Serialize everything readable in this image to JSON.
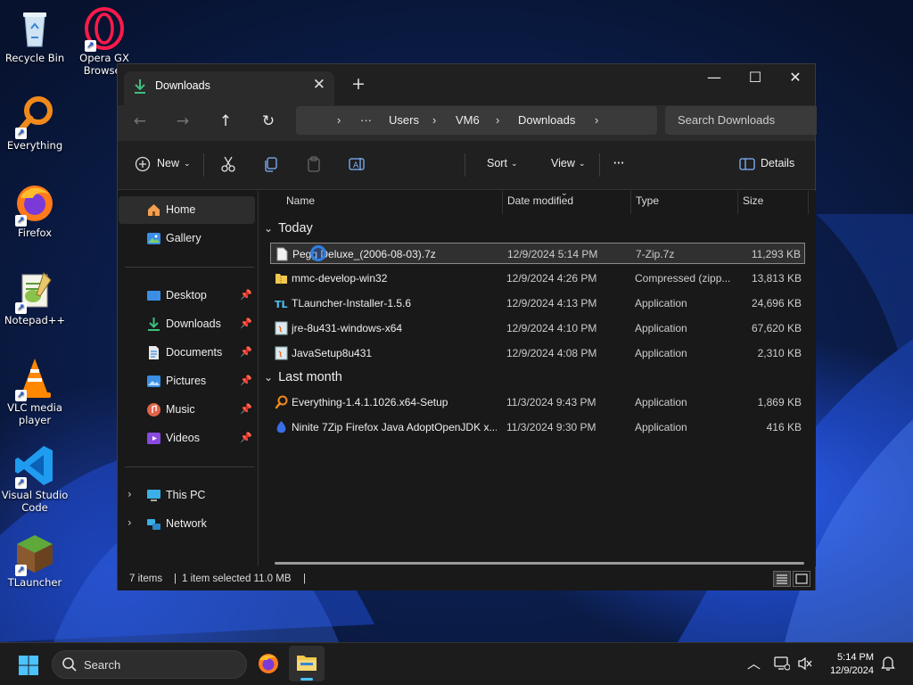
{
  "desktop": {
    "icons": [
      {
        "label": "Recycle Bin",
        "icon": "recycle-bin-icon"
      },
      {
        "label": "Opera GX Browser",
        "icon": "opera-gx-icon"
      },
      {
        "label": "Everything",
        "icon": "everything-search-icon"
      },
      {
        "label": "Firefox",
        "icon": "firefox-icon"
      },
      {
        "label": "Notepad++",
        "icon": "notepad-plus-plus-icon"
      },
      {
        "label": "VLC media player",
        "icon": "vlc-icon"
      },
      {
        "label": "Visual Studio Code",
        "icon": "vscode-icon"
      },
      {
        "label": "TLauncher",
        "icon": "tlauncher-icon"
      }
    ]
  },
  "explorer": {
    "tab_title": "Downloads",
    "breadcrumb": [
      "Users",
      "VM6",
      "Downloads"
    ],
    "breadcrumb_more": "···",
    "search_placeholder": "Search Downloads",
    "toolbar": {
      "new_label": "New",
      "sort_label": "Sort",
      "view_label": "View",
      "more_label": "···",
      "details_label": "Details"
    },
    "sidebar": {
      "home": "Home",
      "gallery": "Gallery",
      "quick": [
        "Desktop",
        "Downloads",
        "Documents",
        "Pictures",
        "Music",
        "Videos"
      ],
      "this_pc": "This PC",
      "network": "Network"
    },
    "columns": {
      "name": "Name",
      "date": "Date modified",
      "type": "Type",
      "size": "Size"
    },
    "groups": [
      {
        "label": "Today",
        "files": [
          {
            "name": "Pegg Deluxe_(2006-08-03).7z",
            "date": "12/9/2024 5:14 PM",
            "type": "7-Zip.7z",
            "size": "11,293 KB",
            "selected": true
          },
          {
            "name": "mmc-develop-win32",
            "date": "12/9/2024 4:26 PM",
            "type": "Compressed (zipp...",
            "size": "13,813 KB"
          },
          {
            "name": "TLauncher-Installer-1.5.6",
            "date": "12/9/2024 4:13 PM",
            "type": "Application",
            "size": "24,696 KB"
          },
          {
            "name": "jre-8u431-windows-x64",
            "date": "12/9/2024 4:10 PM",
            "type": "Application",
            "size": "67,620 KB"
          },
          {
            "name": "JavaSetup8u431",
            "date": "12/9/2024 4:08 PM",
            "type": "Application",
            "size": "2,310 KB"
          }
        ]
      },
      {
        "label": "Last month",
        "files": [
          {
            "name": "Everything-1.4.1.1026.x64-Setup",
            "date": "11/3/2024 9:43 PM",
            "type": "Application",
            "size": "1,869 KB"
          },
          {
            "name": "Ninite 7Zip Firefox Java AdoptOpenJDK x...",
            "date": "11/3/2024 9:30 PM",
            "type": "Application",
            "size": "416 KB"
          }
        ]
      }
    ],
    "status": {
      "count": "7 items",
      "selection": "1 item selected  11.0 MB"
    }
  },
  "taskbar": {
    "search_label": "Search",
    "time": "5:14 PM",
    "date": "12/9/2024"
  }
}
